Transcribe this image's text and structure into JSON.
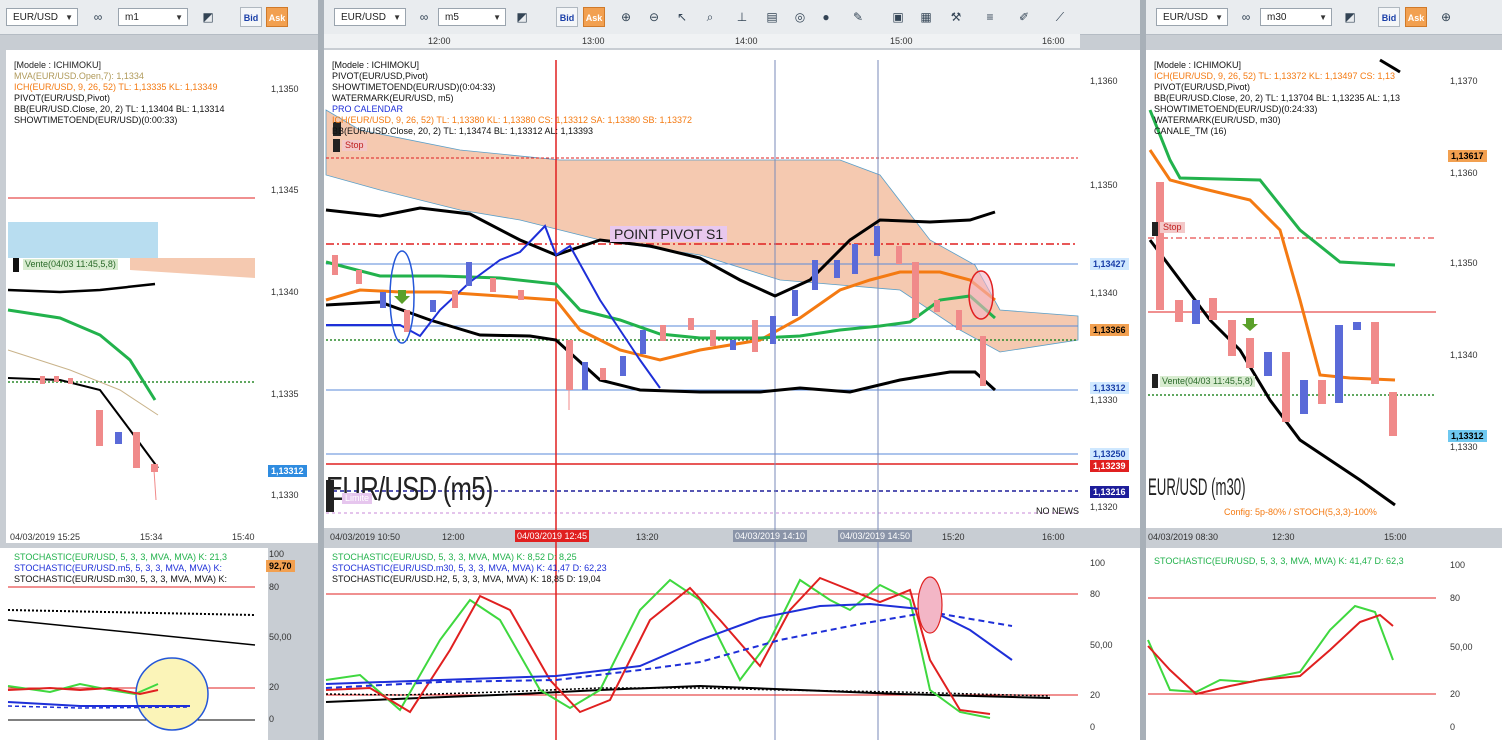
{
  "colors": {
    "ask_bg": "#f2a050",
    "ichimoku_orange": "#f47a12",
    "kl_green": "#22b24c",
    "pivot_red": "#e02020",
    "bb_black": "#000000",
    "blue": "#1e2fd8",
    "cloud": "#f5c9b0",
    "cloud_blue": "#b8ddf0"
  },
  "toolbar": {
    "left": {
      "symbol": "EUR/USD",
      "timeframe": "m1",
      "bid": "Bid",
      "ask": "Ask"
    },
    "center": {
      "symbol": "EUR/USD",
      "timeframe": "m5",
      "bid": "Bid",
      "ask": "Ask"
    },
    "right": {
      "symbol": "EUR/USD",
      "timeframe": "m30",
      "bid": "Bid",
      "ask": "Ask"
    },
    "icons": [
      "link-icon",
      "chart-type-icon",
      "zoom-in-icon",
      "zoom-out-icon",
      "cursor-icon",
      "zoom-fit-icon",
      "bar-icon",
      "note-icon",
      "palette-icon",
      "globe-icon",
      "ruler-icon",
      "image-icon",
      "template-icon",
      "tools-icon",
      "lines-icon",
      "pen-icon",
      "trend-icon"
    ]
  },
  "left": {
    "info": [
      "[Modele : ICHIMOKU]",
      "MVA(EUR/USD.Open,7): 1,1334",
      "ICH(EUR/USD, 9, 26, 52)  TL: 1,13335  KL: 1,13349",
      "PIVOT(EUR/USD,Pivot)",
      "BB(EUR/USD.Close, 20, 2)  TL: 1,13404  BL: 1,13314",
      "SHOWTIMETOEND(EUR/USD)(0:00:33)"
    ],
    "yticks": [
      "1,1350",
      "1,1345",
      "1,1340",
      "1,1335",
      "1,1330"
    ],
    "price_box": "1,13312",
    "vente_label": "Vente(04/03 11:45,5,8)",
    "xticks": [
      "04/03/2019 15:25",
      "15:34",
      "15:40"
    ],
    "stoch": {
      "line1": "STOCHASTIC(EUR/USD, 5, 3, 3, MVA, MVA)  K: 21,3",
      "line2": "STOCHASTIC(EUR/USD.m5, 5, 3, 3, MVA, MVA)  K:",
      "line3": "STOCHASTIC(EUR/USD.m30, 5, 3, 3, MVA, MVA)  K:",
      "yticks": [
        "100",
        "80",
        "50,00",
        "20",
        "0"
      ],
      "badge": "92,70"
    }
  },
  "center": {
    "info": [
      "[Modele : ICHIMOKU]",
      "PIVOT(EUR/USD,Pivot)",
      "SHOWTIMETOEND(EUR/USD)(0:04:33)",
      "WATERMARK(EUR/USD, m5)",
      "PRO CALENDAR",
      "ICH(EUR/USD, 9, 26, 52)  TL: 1,13380  KL: 1,13380  CS: 1,13312  SA: 1,13380  SB: 1,13372",
      "BB(EUR/USD.Close, 20, 2)  TL: 1,13474  BL: 1,13312  AL: 1,13393"
    ],
    "top_times": [
      "12:00",
      "13:00",
      "14:00",
      "15:00",
      "16:00"
    ],
    "yticks": [
      "1,1360",
      "1,1350",
      "1,1340",
      "1,1330",
      "1,1320"
    ],
    "price_boxes": {
      "a": "1,13427",
      "b": "1,13366",
      "c": "1,13312",
      "d": "1,13250",
      "e": "1,13239",
      "f": "1,13216"
    },
    "stop_label": "Stop",
    "limite_label": "Limite",
    "pivot_label": "POINT PIVOT S1",
    "watermark": "EUR/USD (m5)",
    "no_news": "NO NEWS",
    "xticks": [
      "04/03/2019 10:50",
      "12:00",
      "04/03/2019 12:45",
      "13:20",
      "04/03/2019 14:10",
      "04/03/2019 14:50",
      "15:20",
      "16:00"
    ],
    "stoch": {
      "line1": "STOCHASTIC(EUR/USD, 5, 3, 3, MVA, MVA)  K: 8,52  D: 8,25",
      "line2": "STOCHASTIC(EUR/USD.m30, 5, 3, 3, MVA, MVA)  K: 41,47  D: 62,23",
      "line3": "STOCHASTIC(EUR/USD.H2, 5, 3, 3, MVA, MVA)  K: 18,85  D: 19,04",
      "yticks": [
        "100",
        "80",
        "50,00",
        "20",
        "0"
      ]
    }
  },
  "right": {
    "info": [
      "[Modele : ICHIMOKU]",
      "ICH(EUR/USD, 9, 26, 52)  TL: 1,13372  KL: 1,13497  CS: 1,13",
      "PIVOT(EUR/USD,Pivot)",
      "BB(EUR/USD.Close, 20, 2)  TL: 1,13704  BL: 1,13235  AL: 1,13",
      "SHOWTIMETOEND(EUR/USD)(0:24:33)",
      "WATERMARK(EUR/USD, m30)",
      "CANALE_TM (16)"
    ],
    "yticks": [
      "1,1370",
      "1,1360",
      "1,1350",
      "1,1340",
      "1,1330"
    ],
    "price_box_orange": "1,13617",
    "price_box_blue": "1,13312",
    "stop_label": "Stop",
    "vente_label": "Vente(04/03 11:45,5,8)",
    "watermark": "EUR/USD (m30)",
    "config": "Config: 5p-80% / STOCH(5,3,3)-100%",
    "xticks": [
      "04/03/2019 08:30",
      "12:30",
      "15:00"
    ],
    "stoch": {
      "line1": "STOCHASTIC(EUR/USD, 5, 3, 3, MVA, MVA)  K: 41,47  D: 62,3",
      "yticks": [
        "100",
        "80",
        "50,00",
        "20",
        "0"
      ]
    }
  }
}
